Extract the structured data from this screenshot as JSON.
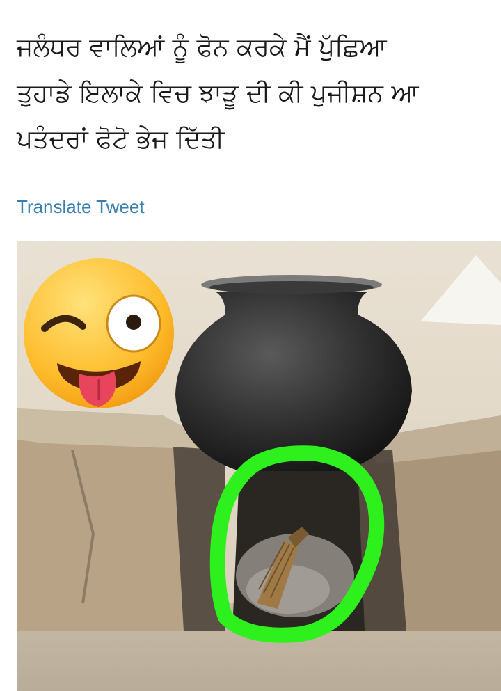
{
  "tweet": {
    "text_lines": [
      "ਜਲੰਧਰ ਵਾਲਿਆਂ ਨੂੰ ਫੋਨ ਕਰਕੇ ਮੈਂ ਪੁੱਛਿਆ",
      "ਤੁਹਾਡੇ ਇਲਾਕੇ ਵਿਚ ਝਾੜੂ ਦੀ ਕੀ ਪੁਜੀਸ਼ਨ ਆ",
      "ਪਤੰਦਰਾਂ ਫੋਟੋ ਭੇਜ ਦਿੱਤੀ"
    ],
    "translate_label": "Translate Tweet"
  },
  "photo": {
    "emoji_icon": "winking-face-with-tongue-icon",
    "highlight_color": "#2df01c"
  }
}
